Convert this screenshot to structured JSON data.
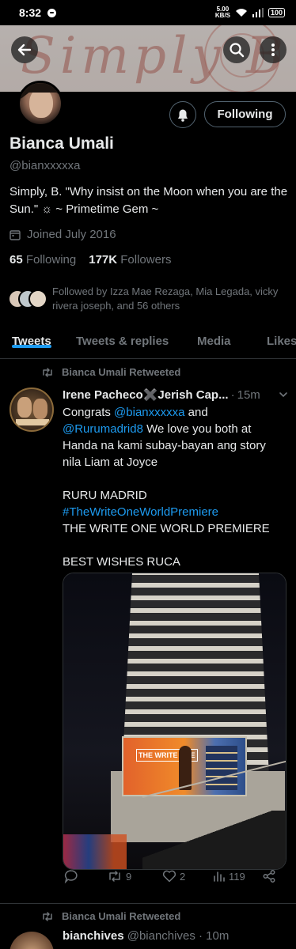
{
  "status_bar": {
    "time": "8:32",
    "speed_value": "5.00",
    "speed_unit": "KB/S",
    "battery": "100"
  },
  "banner": {
    "text": "Simply B"
  },
  "profile": {
    "name": "Bianca Umali",
    "handle": "@bianxxxxxa",
    "bio": "Simply, B.  \"Why insist on the Moon when you are the Sun.\" ☼  ~ Primetime Gem ~",
    "joined": "Joined July 2016",
    "following_count": "65",
    "following_label": "Following",
    "followers_count": "177K",
    "followers_label": "Followers",
    "followed_by": "Followed by Izza Mae Rezaga, Mia Legada, vicky rivera joseph, and 56 others",
    "follow_button": "Following"
  },
  "tabs": [
    {
      "label": "Tweets",
      "active": true
    },
    {
      "label": "Tweets & replies",
      "active": false
    },
    {
      "label": "Media",
      "active": false
    },
    {
      "label": "Likes",
      "active": false
    }
  ],
  "tweets": [
    {
      "retweeted_by": "Bianca Umali Retweeted",
      "author": "Irene Pacheco✖️Jerish Cap...",
      "time": "15m",
      "lines": {
        "l1_prefix": "Congrats ",
        "l1_mention": "@bianxxxxxa",
        "l1_suffix": "  and",
        "l2_mention": "@Rurumadrid8",
        "l2_suffix": " We love you both at",
        "l3": "Handa na kami subay-bayan ang story",
        "l4": "nila Liam at Joyce",
        "l5": "RURU MADRID",
        "l6_hashtag": "#TheWriteOneWorldPremiere",
        "l7": "THE WRITE ONE WORLD PREMIERE",
        "l8": "BEST WISHES RUCA"
      },
      "media_text": "THE WRITE ONE",
      "stats": {
        "retweets": "9",
        "likes": "2",
        "views": "119"
      }
    },
    {
      "retweeted_by": "Bianca Umali Retweeted",
      "author": "bianchives",
      "handle": "@bianchives",
      "time": "10m"
    }
  ],
  "colors": {
    "accent": "#1d9bf0",
    "muted": "#71767b",
    "text": "#e7e9ea",
    "background": "#000000"
  }
}
